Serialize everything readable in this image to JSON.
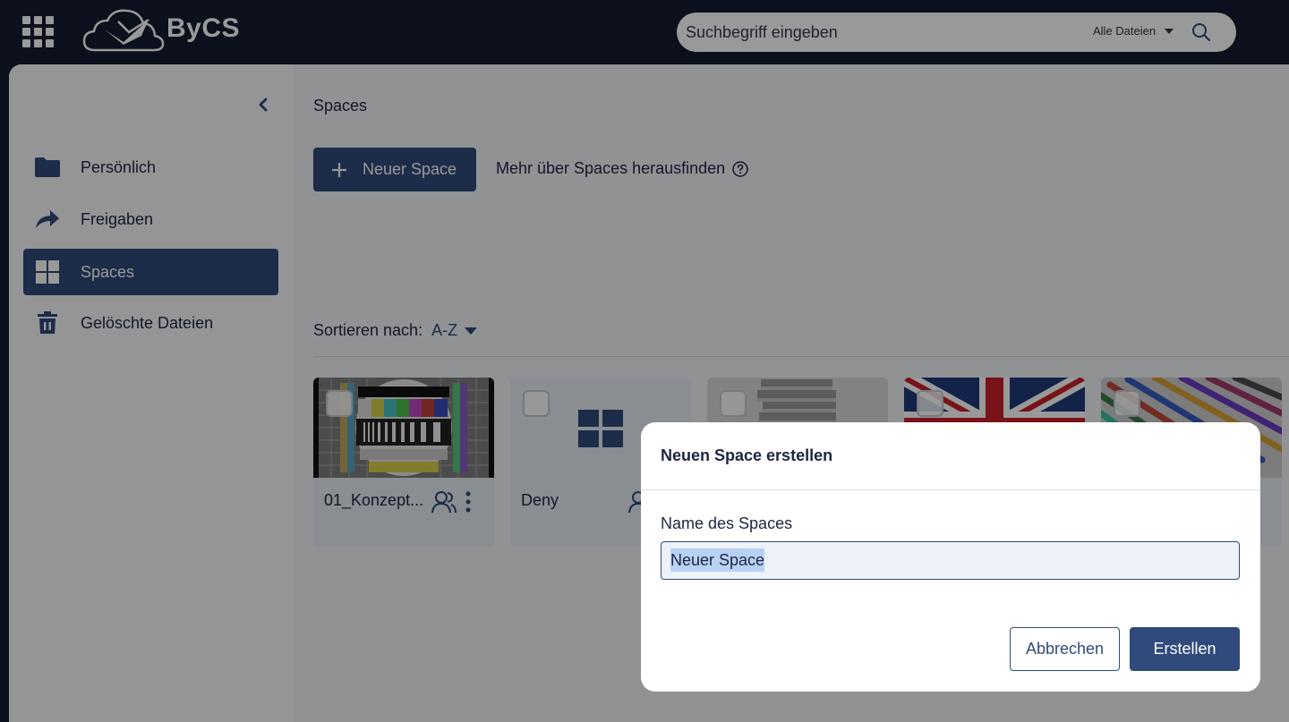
{
  "app": {
    "brand": "ByCS"
  },
  "search": {
    "placeholder": "Suchbegriff eingeben",
    "scope": "Alle Dateien"
  },
  "sidebar": {
    "items": [
      {
        "label": "Persönlich",
        "icon": "folder-icon",
        "active": false
      },
      {
        "label": "Freigaben",
        "icon": "share-arrow-icon",
        "active": false
      },
      {
        "label": "Spaces",
        "icon": "grid-icon",
        "active": true
      },
      {
        "label": "Gelöschte Dateien",
        "icon": "trash-icon",
        "active": false
      }
    ]
  },
  "main": {
    "breadcrumb": "Spaces",
    "new_space_label": "Neuer Space",
    "more_link": "Mehr über Spaces herausfinden",
    "sort_label": "Sortieren nach:",
    "sort_value": "A-Z",
    "cards": [
      {
        "title": "01_Konzept...",
        "thumb": "test-pattern"
      },
      {
        "title": "Deny",
        "thumb": "grid-placeholder"
      },
      {
        "title": "",
        "thumb": "books"
      },
      {
        "title": "",
        "thumb": "union-jack"
      },
      {
        "title": "",
        "thumb": "pencils"
      }
    ]
  },
  "modal": {
    "title": "Neuen Space erstellen",
    "label": "Name des Spaces",
    "input_value": "Neuer Space",
    "cancel_label": "Abbrechen",
    "create_label": "Erstellen"
  },
  "colors": {
    "primary": "#2f4a7b",
    "topbar": "#141a30",
    "panel": "#f1f3f5"
  }
}
